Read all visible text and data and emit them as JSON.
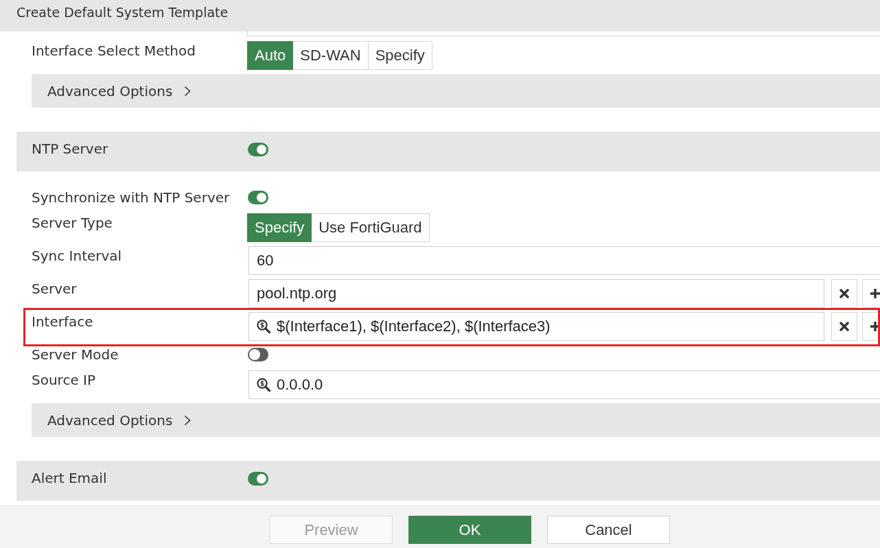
{
  "dialog": {
    "title": "Create Default System Template"
  },
  "form": [
    {
      "kind": "clipped-field",
      "highlighted": false
    },
    {
      "kind": "segmented",
      "label": "Interface Select Method",
      "highlighted": false,
      "options": [
        {
          "label": "Auto",
          "selected": true
        },
        {
          "label": "SD-WAN",
          "selected": false
        },
        {
          "label": "Specify",
          "selected": false
        }
      ]
    },
    {
      "kind": "expander",
      "label": "Advanced Options",
      "expanded": false,
      "highlighted": false
    },
    {
      "kind": "section",
      "label": "NTP Server",
      "on": true,
      "highlighted": false
    },
    {
      "kind": "toggle",
      "label": "Synchronize with NTP Server",
      "on": true,
      "highlighted": false
    },
    {
      "kind": "segmented",
      "label": "Server Type",
      "highlighted": false,
      "options": [
        {
          "label": "Specify",
          "selected": true
        },
        {
          "label": "Use FortiGuard",
          "selected": false
        }
      ]
    },
    {
      "kind": "input",
      "label": "Sync Interval",
      "value": "60",
      "picker": false,
      "highlighted": false
    },
    {
      "kind": "list-input",
      "label": "Server",
      "value": "pool.ntp.org",
      "picker": false,
      "highlighted": false
    },
    {
      "kind": "list-input",
      "label": "Interface",
      "value": "$(Interface1), $(Interface2), $(Interface3)",
      "picker": true,
      "highlighted": true
    },
    {
      "kind": "toggle",
      "label": "Server Mode",
      "on": false,
      "highlighted": false
    },
    {
      "kind": "input",
      "label": "Source IP",
      "value": "0.0.0.0",
      "picker": true,
      "highlighted": false
    },
    {
      "kind": "expander",
      "label": "Advanced Options",
      "expanded": false,
      "highlighted": false
    },
    {
      "kind": "section",
      "label": "Alert Email",
      "on": true,
      "highlighted": false
    }
  ],
  "footer": {
    "buttons": [
      {
        "label": "Preview",
        "kind": "secondary",
        "disabled": true
      },
      {
        "label": "OK",
        "kind": "primary",
        "disabled": false
      },
      {
        "label": "Cancel",
        "kind": "secondary",
        "disabled": false
      }
    ]
  }
}
